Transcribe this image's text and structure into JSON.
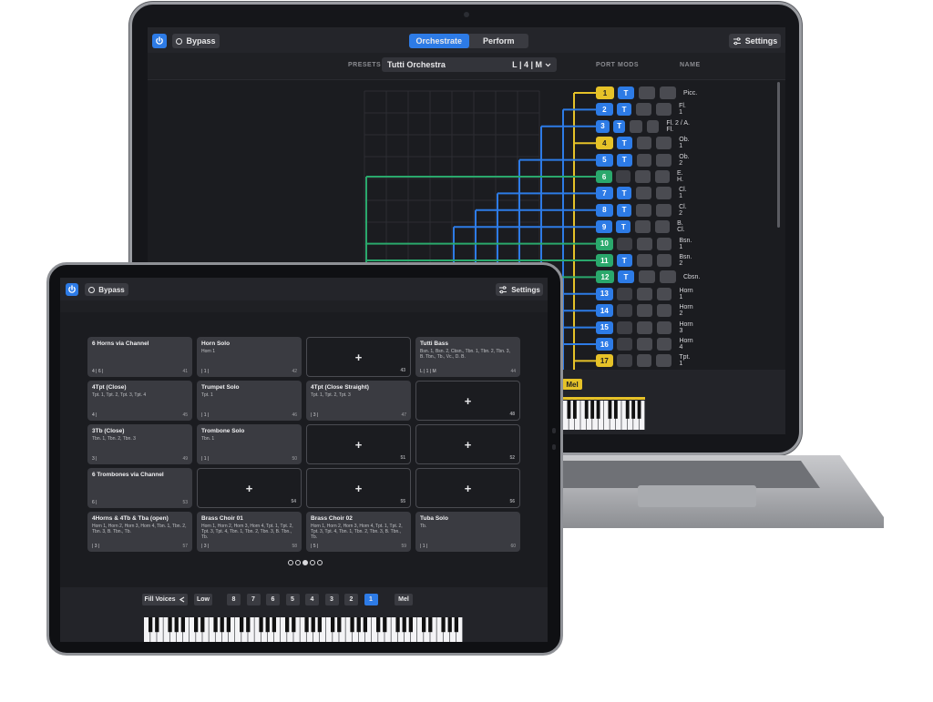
{
  "laptop": {
    "bypass_label": "Bypass",
    "tabs": [
      {
        "label": "Orchestrate",
        "active": true
      },
      {
        "label": "Perform",
        "active": false
      }
    ],
    "settings_label": "Settings",
    "presets_label": "PRESETS",
    "preset_name": "Tutti Orchestra",
    "preset_suffix": "L | 4 | M",
    "columns": {
      "port": "PORT",
      "mods": "MODS",
      "name": "NAME"
    },
    "rows": [
      {
        "port": "1",
        "color": "y",
        "t": true,
        "name": "Picc."
      },
      {
        "port": "2",
        "color": "b",
        "t": true,
        "name": "Fl. 1"
      },
      {
        "port": "3",
        "color": "b",
        "t": true,
        "name": "Fl. 2 / A. Fl."
      },
      {
        "port": "4",
        "color": "y",
        "t": true,
        "name": "Ob. 1"
      },
      {
        "port": "5",
        "color": "b",
        "t": true,
        "name": "Ob. 2"
      },
      {
        "port": "6",
        "color": "g",
        "t": false,
        "name": "E. H."
      },
      {
        "port": "7",
        "color": "b",
        "t": true,
        "name": "Cl. 1"
      },
      {
        "port": "8",
        "color": "b",
        "t": true,
        "name": "Cl. 2"
      },
      {
        "port": "9",
        "color": "b",
        "t": true,
        "name": "B. Cl."
      },
      {
        "port": "10",
        "color": "g",
        "t": false,
        "name": "Bsn. 1"
      },
      {
        "port": "11",
        "color": "g",
        "t": true,
        "name": "Bsn. 2"
      },
      {
        "port": "12",
        "color": "g",
        "t": true,
        "name": "Cbsn."
      },
      {
        "port": "13",
        "color": "b",
        "t": false,
        "name": "Horn 1"
      },
      {
        "port": "14",
        "color": "b",
        "t": false,
        "name": "Horn 2"
      },
      {
        "port": "15",
        "color": "b",
        "t": false,
        "name": "Horn 3"
      },
      {
        "port": "16",
        "color": "b",
        "t": false,
        "name": "Horn 4"
      },
      {
        "port": "17",
        "color": "y",
        "t": false,
        "name": "Tpt. 1"
      }
    ],
    "mel_label": "Mel",
    "colors": {
      "blue": "#2d7be6",
      "yellow": "#e6c228",
      "green": "#2aa86c"
    }
  },
  "tablet": {
    "bypass_label": "Bypass",
    "settings_label": "Settings",
    "cells": [
      {
        "title": "6 Horns via Channel",
        "sub": "",
        "voices": "4 | 6 |",
        "num": "41"
      },
      {
        "title": "Horn Solo",
        "sub": "Horn 1",
        "voices": "| 1 |",
        "num": "42"
      },
      {
        "empty": true,
        "num": "43"
      },
      {
        "title": "Tutti Bass",
        "sub": "Bsn. 1, Bsn. 2, Cbsn., Tbn. 1, Tbn. 2, Tbn. 3, B. Tbn., Tb., Vc., D. B.",
        "voices": "L | 1 | M",
        "num": "44"
      },
      {
        "title": "4Tpt (Close)",
        "sub": "Tpt. 1, Tpt. 2, Tpt. 3, Tpt. 4",
        "voices": "4 |",
        "num": "45"
      },
      {
        "title": "Trumpet Solo",
        "sub": "Tpt. 1",
        "voices": "| 1 |",
        "num": "46"
      },
      {
        "title": "4Tpt (Close Straight)",
        "sub": "Tpt. 1, Tpt. 2, Tpt. 3",
        "voices": "| 3 |",
        "num": "47"
      },
      {
        "empty": true,
        "num": "48"
      },
      {
        "title": "3Tb (Close)",
        "sub": "Tbn. 1, Tbn. 2, Tbn. 3",
        "voices": "3 |",
        "num": "49"
      },
      {
        "title": "Trombone Solo",
        "sub": "Tbn. 1",
        "voices": "| 1 |",
        "num": "50"
      },
      {
        "empty": true,
        "num": "51"
      },
      {
        "empty": true,
        "num": "52"
      },
      {
        "title": "6 Trombones via Channel",
        "sub": "",
        "voices": "6 |",
        "num": "53"
      },
      {
        "empty": true,
        "num": "54"
      },
      {
        "empty": true,
        "num": "55"
      },
      {
        "empty": true,
        "num": "56"
      },
      {
        "title": "4Horns & 4Tb & Tba (open)",
        "sub": "Horn 1, Horn 2, Horn 3, Horn 4, Tbn. 1, Tbn. 2, Tbn. 3, B. Tbn., Tb.",
        "voices": "| 3 |",
        "num": "57"
      },
      {
        "title": "Brass Choir 01",
        "sub": "Horn 1, Horn 2, Horn 3, Horn 4, Tpt. 1, Tpt. 2, Tpt. 3, Tpt. 4, Tbn. 1, Tbn. 2, Tbn. 3, B. Tbn., Tb.",
        "voices": "| 3 |",
        "num": "58"
      },
      {
        "title": "Brass Choir 02",
        "sub": "Horn 1, Horn 2, Horn 3, Horn 4, Tpt. 1, Tpt. 2, Tpt. 3, Tpt. 4, Tbn. 1, Tbn. 2, Tbn. 3, B. Tbn., Tb.",
        "voices": "| 5 |",
        "num": "59"
      },
      {
        "title": "Tuba Solo",
        "sub": "Tb.",
        "voices": "| 1 |",
        "num": "60"
      }
    ],
    "pages": {
      "count": 5,
      "current": 3
    },
    "fill_voices_label": "Fill Voices",
    "low_label": "Low",
    "voices": [
      "8",
      "7",
      "6",
      "5",
      "4",
      "3",
      "2",
      "1"
    ],
    "selected_voice": "1",
    "mel_label": "Mel"
  }
}
